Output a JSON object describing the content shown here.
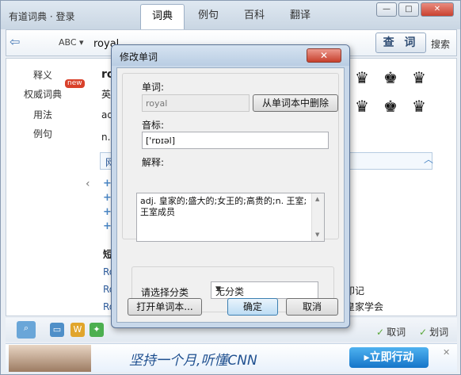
{
  "app": {
    "title": "有道词典 · 登录",
    "tabs": [
      "词典",
      "例句",
      "百科",
      "翻译"
    ],
    "active_tab": 0,
    "window_buttons": [
      "—",
      "□",
      "✕"
    ]
  },
  "toolbar": {
    "back_glyph": "⇦",
    "abc_label": "ABC ▾",
    "search_value": "royal",
    "search_button": "查 词",
    "search_label": "搜索"
  },
  "sidebar": {
    "items": [
      "释义",
      "权威词典",
      "用法",
      "例句"
    ],
    "new_badge": "new"
  },
  "background": {
    "word_head": "roy",
    "line_en": "英",
    "line_adj": "adj",
    "line_n": "n. 皇",
    "web_tab": "网",
    "short_head": "短",
    "link_prefix": "Ro",
    "right_fragment_1": "印记",
    "right_fragment_2": "皇家学会",
    "crowns": [
      "♛",
      "♚",
      "♛",
      "♛",
      "♚",
      "♛",
      "♛",
      "♛"
    ]
  },
  "bottom": {
    "toggle_1": "取词",
    "toggle_2": "划词"
  },
  "ad": {
    "text": "坚持一个月,听懂CNN",
    "action": "▸立即行动",
    "close": "✕"
  },
  "dialog": {
    "title": "修改单词",
    "close": "✕",
    "word_label": "单词:",
    "word_value": "royal",
    "delete_button": "从单词本中删除",
    "phonetic_label": "音标:",
    "phonetic_value": "['rɒɪəl]",
    "definition_label": "解释:",
    "definition_value": "adj. 皇家的;盛大的;女王的;高贵的;n. 王室;王室成员",
    "category_label": "请选择分类",
    "category_value": "无分类",
    "open_wordbook_button": "打开单词本...",
    "ok_button": "确定",
    "cancel_button": "取消"
  }
}
